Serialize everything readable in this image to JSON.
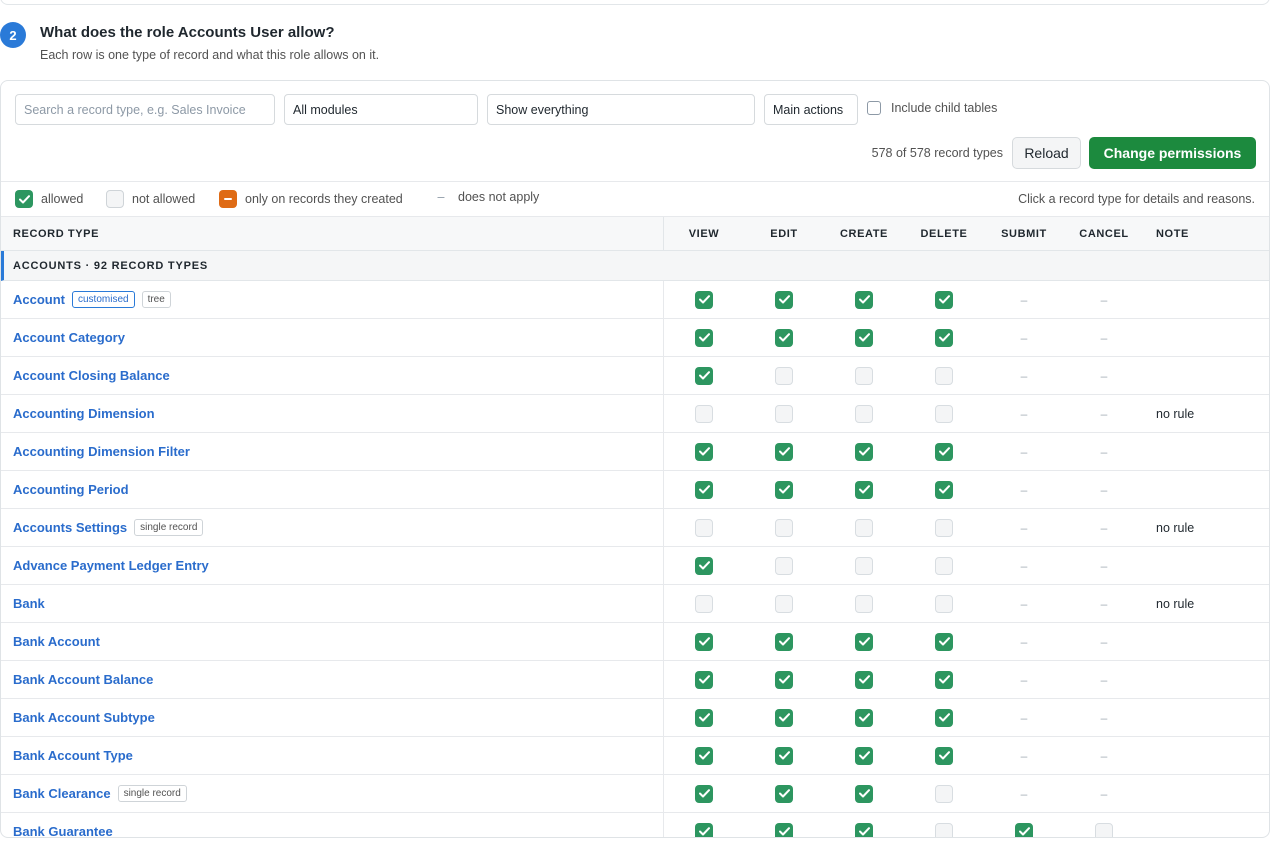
{
  "step": {
    "number": "2",
    "title": "What does the role Accounts User allow?",
    "subtitle": "Each row is one type of record and what this role allows on it."
  },
  "toolbar": {
    "search_placeholder": "Search a record type, e.g. Sales Invoice",
    "module_select": "All modules",
    "show_select": "Show everything",
    "main_actions_label": "Main actions",
    "include_child_label": "Include child tables",
    "count_text": "578 of 578 record types",
    "reload_label": "Reload",
    "change_label": "Change permissions"
  },
  "legend": {
    "allowed": "allowed",
    "not_allowed": "not allowed",
    "own_only": "only on records they created",
    "dash": "–",
    "not_apply": "does not apply",
    "hint": "Click a record type for details and reasons."
  },
  "columns": {
    "name": "RECORD TYPE",
    "view": "VIEW",
    "edit": "EDIT",
    "create": "CREATE",
    "delete": "DELETE",
    "submit": "SUBMIT",
    "cancel": "CANCEL",
    "note": "NOTE"
  },
  "group_label": "ACCOUNTS · 92 RECORD TYPES",
  "colors": {
    "allowed": "#2d9660",
    "own_only": "#df6b15",
    "accent": "#2a7ad8",
    "primary_button": "#1c8a3e"
  },
  "rows": [
    {
      "name": "Account",
      "badges": [
        {
          "text": "customised",
          "style": "blue"
        },
        {
          "text": "tree",
          "style": "grey"
        }
      ],
      "view": "y",
      "edit": "y",
      "create": "y",
      "delete": "y",
      "submit": "-",
      "cancel": "-",
      "note": ""
    },
    {
      "name": "Account Category",
      "badges": [],
      "view": "y",
      "edit": "y",
      "create": "y",
      "delete": "y",
      "submit": "-",
      "cancel": "-",
      "note": ""
    },
    {
      "name": "Account Closing Balance",
      "badges": [],
      "view": "y",
      "edit": "n",
      "create": "n",
      "delete": "n",
      "submit": "-",
      "cancel": "-",
      "note": ""
    },
    {
      "name": "Accounting Dimension",
      "badges": [],
      "view": "n",
      "edit": "n",
      "create": "n",
      "delete": "n",
      "submit": "-",
      "cancel": "-",
      "note": "no rule"
    },
    {
      "name": "Accounting Dimension Filter",
      "badges": [],
      "view": "y",
      "edit": "y",
      "create": "y",
      "delete": "y",
      "submit": "-",
      "cancel": "-",
      "note": ""
    },
    {
      "name": "Accounting Period",
      "badges": [],
      "view": "y",
      "edit": "y",
      "create": "y",
      "delete": "y",
      "submit": "-",
      "cancel": "-",
      "note": ""
    },
    {
      "name": "Accounts Settings",
      "badges": [
        {
          "text": "single record",
          "style": "grey"
        }
      ],
      "view": "n",
      "edit": "n",
      "create": "n",
      "delete": "n",
      "submit": "-",
      "cancel": "-",
      "note": "no rule"
    },
    {
      "name": "Advance Payment Ledger Entry",
      "badges": [],
      "view": "y",
      "edit": "n",
      "create": "n",
      "delete": "n",
      "submit": "-",
      "cancel": "-",
      "note": ""
    },
    {
      "name": "Bank",
      "badges": [],
      "view": "n",
      "edit": "n",
      "create": "n",
      "delete": "n",
      "submit": "-",
      "cancel": "-",
      "note": "no rule"
    },
    {
      "name": "Bank Account",
      "badges": [],
      "view": "y",
      "edit": "y",
      "create": "y",
      "delete": "y",
      "submit": "-",
      "cancel": "-",
      "note": ""
    },
    {
      "name": "Bank Account Balance",
      "badges": [],
      "view": "y",
      "edit": "y",
      "create": "y",
      "delete": "y",
      "submit": "-",
      "cancel": "-",
      "note": ""
    },
    {
      "name": "Bank Account Subtype",
      "badges": [],
      "view": "y",
      "edit": "y",
      "create": "y",
      "delete": "y",
      "submit": "-",
      "cancel": "-",
      "note": ""
    },
    {
      "name": "Bank Account Type",
      "badges": [],
      "view": "y",
      "edit": "y",
      "create": "y",
      "delete": "y",
      "submit": "-",
      "cancel": "-",
      "note": ""
    },
    {
      "name": "Bank Clearance",
      "badges": [
        {
          "text": "single record",
          "style": "grey"
        }
      ],
      "view": "y",
      "edit": "y",
      "create": "y",
      "delete": "n",
      "submit": "-",
      "cancel": "-",
      "note": ""
    },
    {
      "name": "Bank Guarantee",
      "badges": [],
      "view": "y",
      "edit": "y",
      "create": "y",
      "delete": "n",
      "submit": "y",
      "cancel": "n",
      "note": ""
    }
  ]
}
